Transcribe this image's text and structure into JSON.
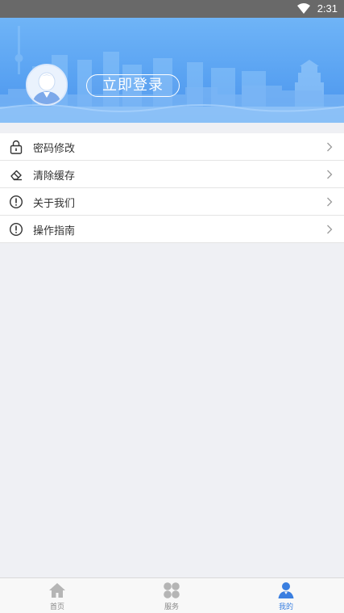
{
  "status_bar": {
    "time": "2:31",
    "icons": [
      "wifi-icon"
    ]
  },
  "header": {
    "login_button": "立即登录",
    "avatar": "avatar-icon"
  },
  "menu": {
    "items": [
      {
        "label": "密码修改",
        "icon": "lock-icon"
      },
      {
        "label": "清除缓存",
        "icon": "eraser-icon"
      },
      {
        "label": "关于我们",
        "icon": "info-icon"
      },
      {
        "label": "操作指南",
        "icon": "info-icon"
      }
    ]
  },
  "tabbar": {
    "tabs": [
      {
        "label": "首页",
        "icon": "home-icon",
        "active": false
      },
      {
        "label": "服务",
        "icon": "grid-icon",
        "active": false
      },
      {
        "label": "我的",
        "icon": "user-icon",
        "active": true
      }
    ]
  },
  "colors": {
    "accent": "#3a7fe0",
    "header_blue": "#5aa3f2"
  }
}
